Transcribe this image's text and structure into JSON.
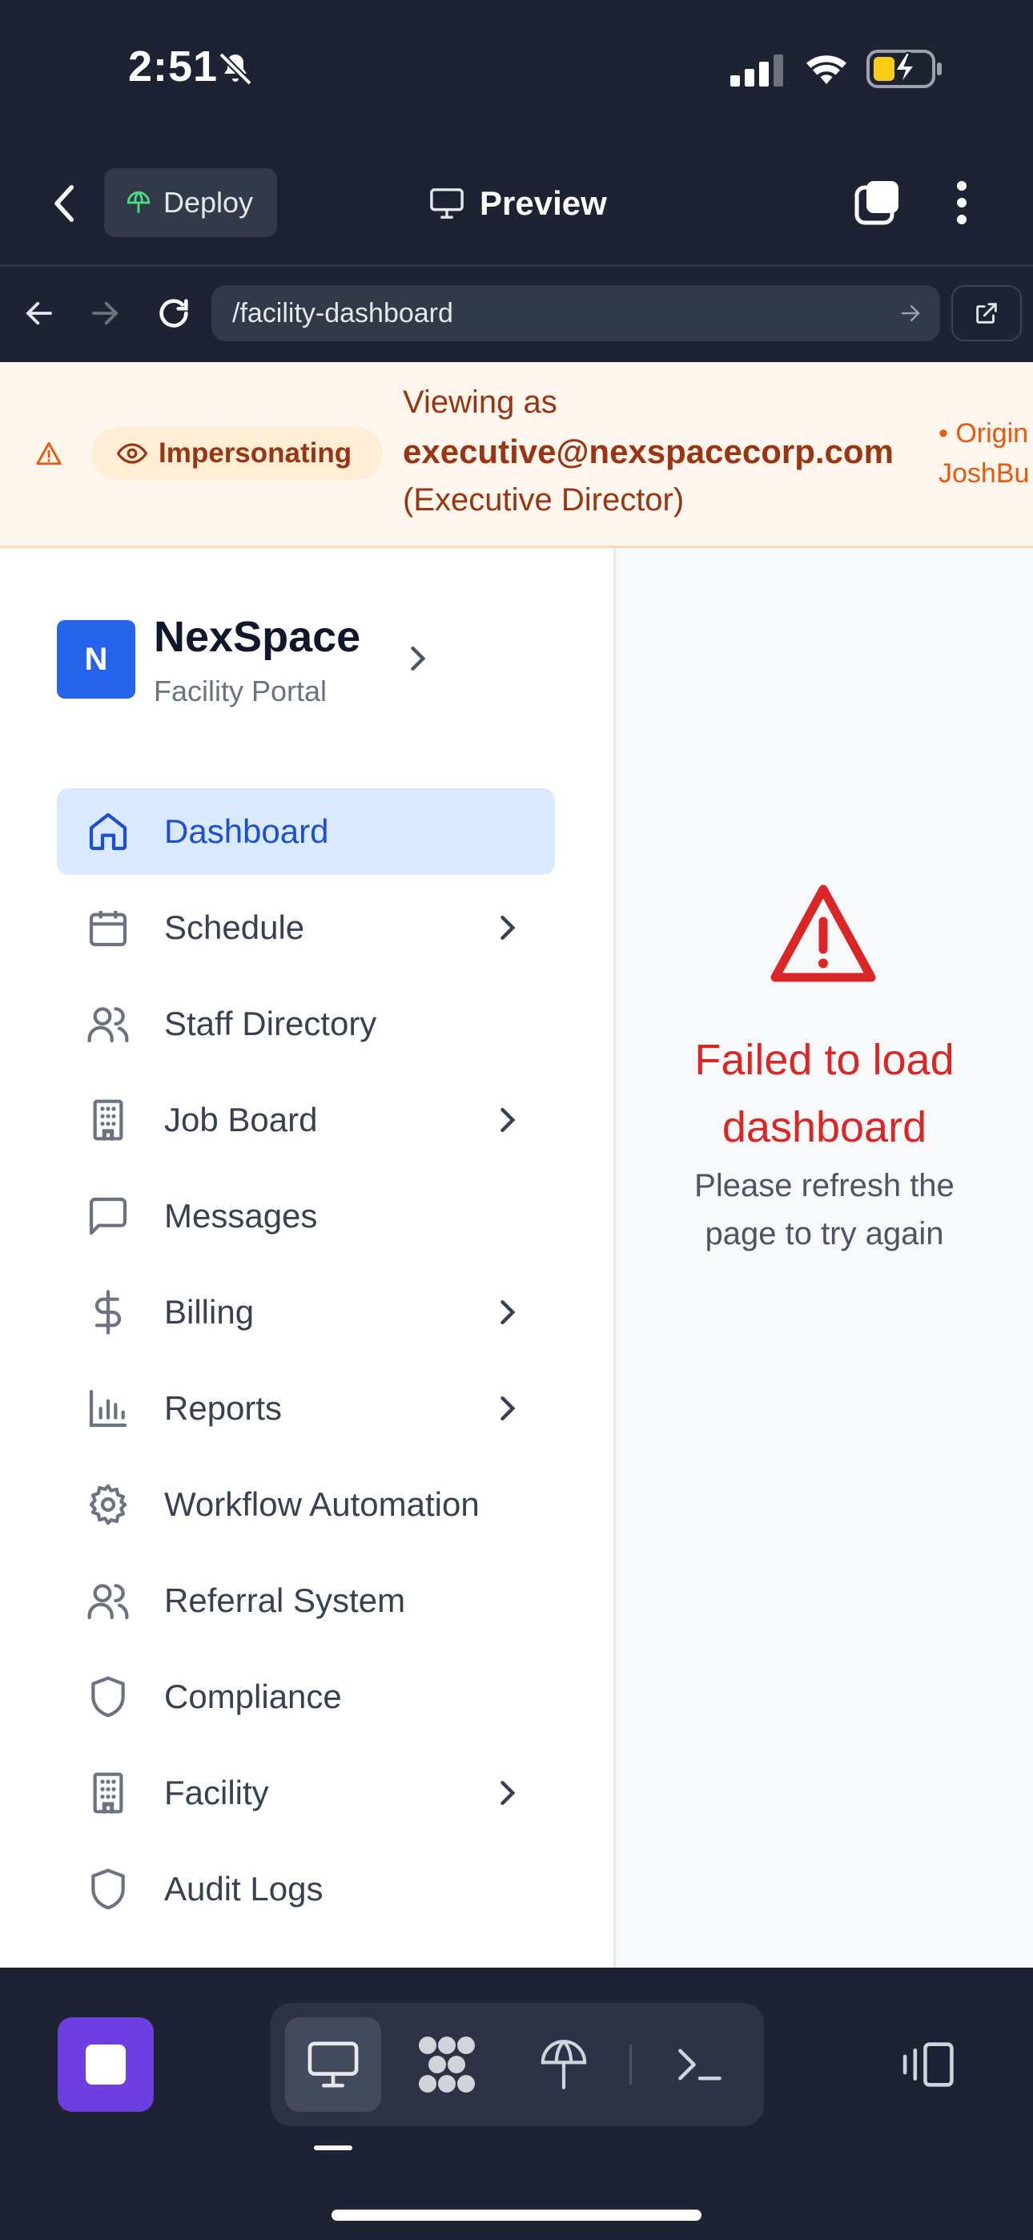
{
  "status_bar": {
    "time": "2:51"
  },
  "app_bar": {
    "deploy_label": "Deploy",
    "title": "Preview"
  },
  "browser": {
    "url": "/facility-dashboard"
  },
  "banner": {
    "badge": "Impersonating",
    "line1": "Viewing as",
    "email": "executive@nexspacecorp.com",
    "role": "(Executive Director)",
    "original_line1": "• Origin",
    "original_line2": "JoshBu"
  },
  "sidebar": {
    "logo_letter": "N",
    "brand": "NexSpace",
    "subtitle": "Facility Portal",
    "items": [
      {
        "label": "Dashboard",
        "icon": "home-icon",
        "active": true,
        "has_submenu": false
      },
      {
        "label": "Schedule",
        "icon": "calendar-icon",
        "active": false,
        "has_submenu": true
      },
      {
        "label": "Staff Directory",
        "icon": "users-icon",
        "active": false,
        "has_submenu": false
      },
      {
        "label": "Job Board",
        "icon": "building-icon",
        "active": false,
        "has_submenu": true
      },
      {
        "label": "Messages",
        "icon": "message-icon",
        "active": false,
        "has_submenu": false
      },
      {
        "label": "Billing",
        "icon": "dollar-icon",
        "active": false,
        "has_submenu": true
      },
      {
        "label": "Reports",
        "icon": "bar-chart-icon",
        "active": false,
        "has_submenu": true
      },
      {
        "label": "Workflow Automation",
        "icon": "gear-icon",
        "active": false,
        "has_submenu": false
      },
      {
        "label": "Referral System",
        "icon": "users-icon",
        "active": false,
        "has_submenu": false
      },
      {
        "label": "Compliance",
        "icon": "shield-icon",
        "active": false,
        "has_submenu": false
      },
      {
        "label": "Facility",
        "icon": "building-icon",
        "active": false,
        "has_submenu": true
      },
      {
        "label": "Audit Logs",
        "icon": "shield-icon",
        "active": false,
        "has_submenu": false
      }
    ]
  },
  "main": {
    "error_title_line1": "Failed to load",
    "error_title_line2": "dashboard",
    "error_message_line1": "Please refresh the",
    "error_message_line2": "page to try again"
  },
  "colors": {
    "accent": "#2563eb",
    "active_bg": "#dbeafe",
    "error": "#dc2626",
    "banner_bg": "#fff7ed",
    "chrome_bg": "#1e2333",
    "stop_button": "#6d3fe0"
  }
}
